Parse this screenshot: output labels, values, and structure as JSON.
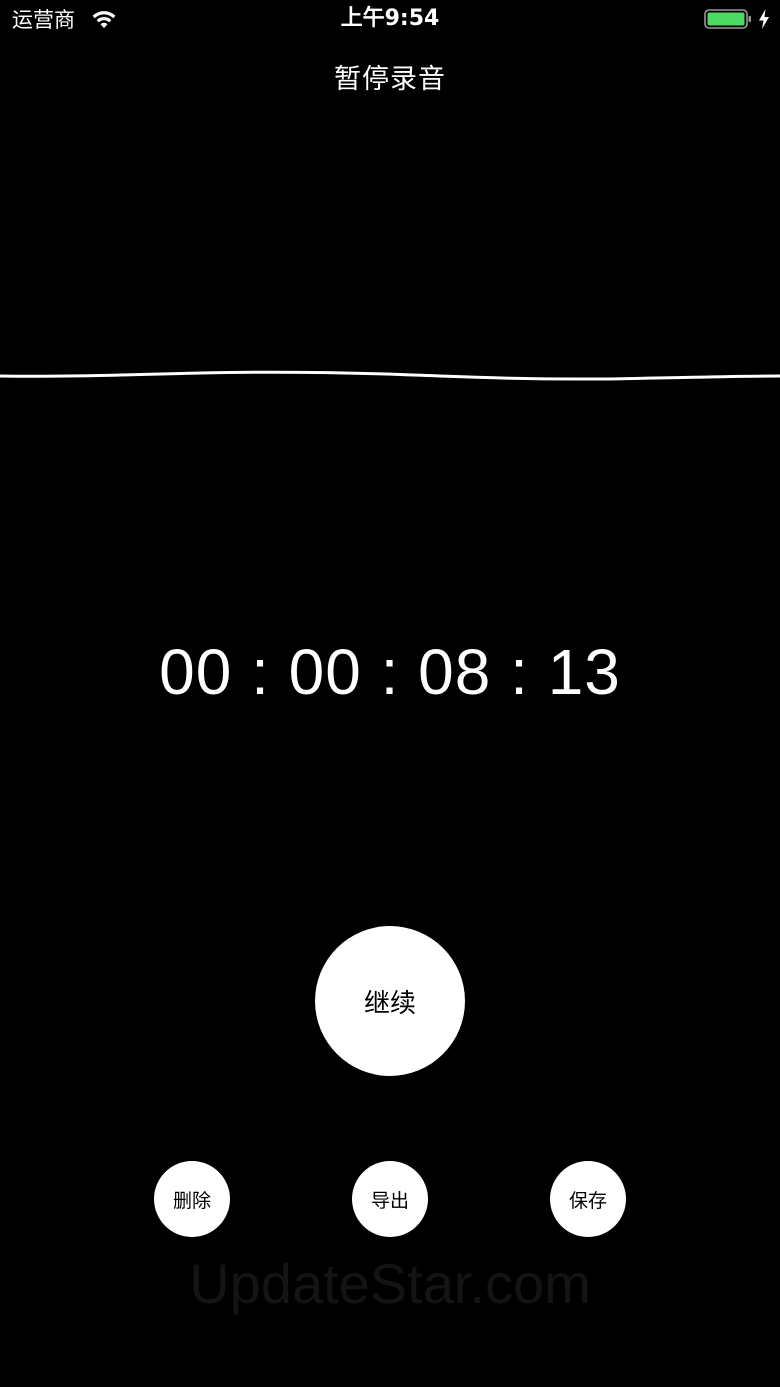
{
  "status_bar": {
    "carrier": "运营商",
    "time": "上午9:54",
    "wifi_icon": "wifi-icon",
    "battery_icon": "battery-icon",
    "charging_icon": "charging-bolt-icon",
    "battery_color": "#4cd964",
    "battery_level": 1.0
  },
  "nav": {
    "title": "暂停录音"
  },
  "recorder": {
    "elapsed_time": "00 : 00 : 08 : 13"
  },
  "controls": {
    "resume_label": "继续",
    "delete_label": "删除",
    "export_label": "导出",
    "save_label": "保存"
  },
  "watermark": "UpdateStar.com",
  "colors": {
    "background": "#000000",
    "foreground": "#ffffff",
    "button_text": "#000000"
  }
}
